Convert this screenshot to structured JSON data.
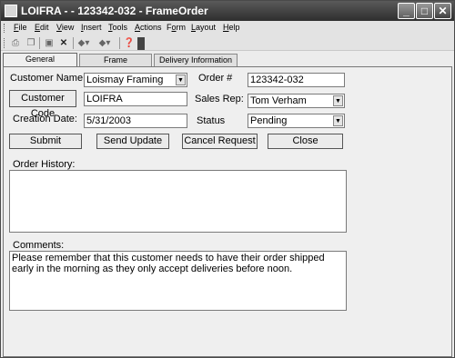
{
  "window": {
    "title": "LOIFRA -  - 123342-032 - FrameOrder",
    "minimize": "_",
    "maximize": "□",
    "close": "✕"
  },
  "menu": [
    "File",
    "Edit",
    "View",
    "Insert",
    "Tools",
    "Actions",
    "Form",
    "Layout",
    "Help"
  ],
  "menu_mnemonics": [
    "F",
    "E",
    "V",
    "I",
    "T",
    "A",
    "o",
    "L",
    "H"
  ],
  "toolbar_icons": [
    "print-icon",
    "copy-icon",
    "save-icon",
    "delete-icon",
    "back-icon",
    "forward-icon",
    "help-icon"
  ],
  "tabs": [
    "General Information",
    "Frame Information",
    "Delivery Information"
  ],
  "form": {
    "customer_name_label": "Customer Name",
    "customer_name_value": "Loismay Framing",
    "order_label": "Order #",
    "order_value": "123342-032",
    "customer_code_button": "Customer Code",
    "customer_code_value": "LOIFRA",
    "sales_rep_label": "Sales Rep:",
    "sales_rep_value": "Tom Verham",
    "creation_date_label": "Creation Date:",
    "creation_date_value": "5/31/2003",
    "status_label": "Status",
    "status_value": "Pending",
    "dropdown_arrow": "▼"
  },
  "buttons": {
    "submit": "Submit",
    "send_update": "Send Update",
    "cancel_request": "Cancel Request",
    "close": "Close"
  },
  "order_history_label": "Order History:",
  "order_history_value": "",
  "comments_label": "Comments:",
  "comments_value": "Please remember that this customer needs to have their order shipped early in the morning as they only accept deliveries before noon."
}
